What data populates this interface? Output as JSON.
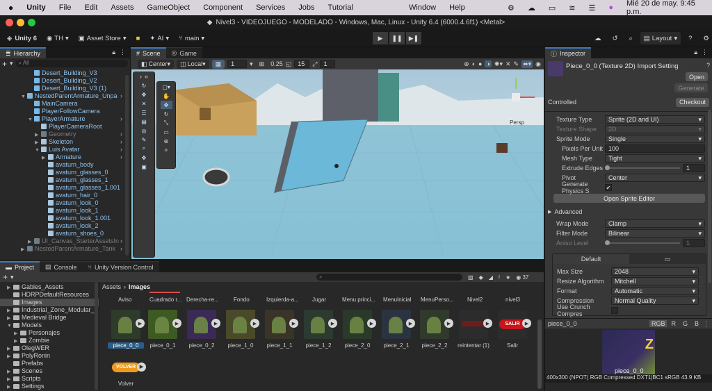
{
  "mac": {
    "app": "Unity",
    "menus": [
      "File",
      "Edit",
      "Assets",
      "GameObject",
      "Component",
      "Services",
      "Jobs",
      "Tutorial"
    ],
    "right_menus": [
      "Window",
      "Help"
    ],
    "clock": "Mié 20 de may.  9:45 p.m."
  },
  "window_title": "Nivel3 - VIDEOJUEGO - MODELADO - Windows, Mac, Linux - Unity 6.4 (6000.4.6f1) <Metal>",
  "toolbar": {
    "unity_label": "Unity 6",
    "account": "TH",
    "asset_store": "Asset Store",
    "ai": "AI",
    "branch": "main",
    "layout": "Layout"
  },
  "hierarchy": {
    "tab": "Hierarchy",
    "search_placeholder": "All",
    "items": [
      {
        "label": "Desert_Building_V3",
        "indent": 1,
        "icon": "cube",
        "color": "blue",
        "arrow": ""
      },
      {
        "label": "Desert_Building_V2",
        "indent": 1,
        "icon": "cube",
        "color": "blue",
        "arrow": ""
      },
      {
        "label": "Desert_Building_V3 (1)",
        "indent": 1,
        "icon": "cube",
        "color": "blue",
        "arrow": ""
      },
      {
        "label": "NestedParentArmature_Unpa",
        "indent": 0,
        "icon": "cube",
        "color": "blue",
        "arrow": "▼"
      },
      {
        "label": "MainCamera",
        "indent": 1,
        "icon": "cube",
        "color": "blue",
        "arrow": ""
      },
      {
        "label": "PlayerFollowCamera",
        "indent": 1,
        "icon": "cube",
        "color": "blue",
        "arrow": ""
      },
      {
        "label": "PlayerArmature",
        "indent": 1,
        "icon": "cube",
        "color": "blue",
        "arrow": "▼"
      },
      {
        "label": "PlayerCameraRoot",
        "indent": 2,
        "icon": "sub",
        "color": "blue",
        "arrow": ""
      },
      {
        "label": "Geometry",
        "indent": 2,
        "icon": "gray",
        "color": "gray",
        "arrow": "▶"
      },
      {
        "label": "Skeleton",
        "indent": 2,
        "icon": "sub",
        "color": "blue",
        "arrow": "▶"
      },
      {
        "label": "Luis Avatar",
        "indent": 2,
        "icon": "sub",
        "color": "blue",
        "arrow": "▼"
      },
      {
        "label": "Armature",
        "indent": 3,
        "icon": "sub",
        "color": "blue",
        "arrow": "▶"
      },
      {
        "label": "avaturn_body",
        "indent": 3,
        "icon": "sub",
        "color": "blue",
        "arrow": ""
      },
      {
        "label": "avaturn_glasses_0",
        "indent": 3,
        "icon": "sub",
        "color": "blue",
        "arrow": ""
      },
      {
        "label": "avaturn_glasses_1",
        "indent": 3,
        "icon": "sub",
        "color": "blue",
        "arrow": ""
      },
      {
        "label": "avaturn_glasses_1.001",
        "indent": 3,
        "icon": "sub",
        "color": "blue",
        "arrow": ""
      },
      {
        "label": "avaturn_hair_0",
        "indent": 3,
        "icon": "sub",
        "color": "blue",
        "arrow": ""
      },
      {
        "label": "avaturn_look_0",
        "indent": 3,
        "icon": "sub",
        "color": "blue",
        "arrow": ""
      },
      {
        "label": "avaturn_look_1",
        "indent": 3,
        "icon": "sub",
        "color": "blue",
        "arrow": ""
      },
      {
        "label": "avaturn_look_1.001",
        "indent": 3,
        "icon": "sub",
        "color": "blue",
        "arrow": ""
      },
      {
        "label": "avaturn_look_2",
        "indent": 3,
        "icon": "sub",
        "color": "blue",
        "arrow": ""
      },
      {
        "label": "avaturn_shoes_0",
        "indent": 3,
        "icon": "sub",
        "color": "blue",
        "arrow": ""
      },
      {
        "label": "UI_Canvas_StarterAssetsIn",
        "indent": 1,
        "icon": "gray",
        "color": "gray",
        "arrow": "▶"
      },
      {
        "label": "NestedParentArmature_Tank",
        "indent": 0,
        "icon": "gray",
        "color": "gray",
        "arrow": "▶"
      }
    ]
  },
  "scene": {
    "tabs": [
      "Scene",
      "Game"
    ],
    "pivot": "Center",
    "space": "Local",
    "grid_value": "1",
    "snap_value": "0.25",
    "angle_value": "15",
    "scale_value": "1",
    "view_label": "Persp"
  },
  "inspector": {
    "tab": "Inspector",
    "asset_title": "Piece_0_0 (Texture 2D) Import Setting",
    "open_btn": "Open",
    "generate_btn": "Generate",
    "controlled": "Controlled",
    "checkout_btn": "Checkout",
    "rows": [
      {
        "label": "Texture Type",
        "value": "Sprite (2D and UI)",
        "kind": "dd"
      },
      {
        "label": "Texture Shape",
        "value": "2D",
        "kind": "dd-dim"
      },
      {
        "label": "Sprite Mode",
        "value": "Single",
        "kind": "dd"
      },
      {
        "label": "Pixels Per Unit",
        "value": "100",
        "kind": "field",
        "sub": true
      },
      {
        "label": "Mesh Type",
        "value": "Tight",
        "kind": "dd",
        "sub": true
      },
      {
        "label": "Extrude Edges",
        "value": "1",
        "kind": "slider",
        "sub": true
      },
      {
        "label": "Pivot",
        "value": "Center",
        "kind": "dd",
        "sub": true
      },
      {
        "label": "Generate Physics S",
        "value": "✔",
        "kind": "check",
        "sub": true
      }
    ],
    "sprite_editor_btn": "Open Sprite Editor",
    "advanced": "Advanced",
    "rows2": [
      {
        "label": "Wrap Mode",
        "value": "Clamp",
        "kind": "dd"
      },
      {
        "label": "Filter Mode",
        "value": "Bilinear",
        "kind": "dd"
      },
      {
        "label": "Aniso Level",
        "value": "1",
        "kind": "slider-dim"
      }
    ],
    "platform_tab": "Default",
    "rows3": [
      {
        "label": "Max Size",
        "value": "2048"
      },
      {
        "label": "Resize Algorithm",
        "value": "Mitchell"
      },
      {
        "label": "Format",
        "value": "Automatic"
      },
      {
        "label": "Compression",
        "value": "Normal Quality"
      },
      {
        "label": "Use Crunch Compres",
        "value": ""
      }
    ],
    "preview_name": "piece_0_0",
    "channels": [
      "RGB",
      "R",
      "G",
      "B"
    ],
    "preview_caption": "piece_0_0",
    "preview_info": "400x300 (NPOT)  RGB Compressed DXT1|BC1 sRGB   43.9 KB"
  },
  "bottom": {
    "tabs": [
      "Project",
      "Console",
      "Unity Version Control"
    ],
    "breadcrumb": [
      "Assets",
      "Images"
    ],
    "count": "37",
    "folders": [
      {
        "label": "Gabies_Assets",
        "indent": 0,
        "arrow": "▶"
      },
      {
        "label": "HDRPDefaultResources",
        "indent": 0,
        "arrow": ""
      },
      {
        "label": "Images",
        "indent": 0,
        "arrow": "",
        "selected": true
      },
      {
        "label": "Industrial_Zone_Modular_I",
        "indent": 0,
        "arrow": "▶"
      },
      {
        "label": "Medieval Bridge",
        "indent": 0,
        "arrow": "▶"
      },
      {
        "label": "Models",
        "indent": 0,
        "arrow": "▼"
      },
      {
        "label": "Personajes",
        "indent": 1,
        "arrow": "▶"
      },
      {
        "label": "Zombie",
        "indent": 1,
        "arrow": "▶"
      },
      {
        "label": "OlegWER",
        "indent": 0,
        "arrow": "▶"
      },
      {
        "label": "PolyRonin",
        "indent": 0,
        "arrow": "▶"
      },
      {
        "label": "Prefabs",
        "indent": 0,
        "arrow": ""
      },
      {
        "label": "Scenes",
        "indent": 0,
        "arrow": "▶"
      },
      {
        "label": "Scripts",
        "indent": 0,
        "arrow": "▶"
      },
      {
        "label": "Settings",
        "indent": 0,
        "arrow": "▶"
      }
    ],
    "column_headers": [
      "Aviso",
      "Cuadrado r...",
      "Derecha-re...",
      "Fondo",
      "Izquierda-a...",
      "Jugar",
      "Menu princi...",
      "MenuInicial",
      "MenuPerso...",
      "Nivel2",
      "nivel3"
    ],
    "assets": [
      {
        "label": "piece_0_0",
        "color": "#2e3b2a",
        "selected": true
      },
      {
        "label": "piece_0_1",
        "color": "#3d5a22"
      },
      {
        "label": "piece_0_2",
        "color": "#3a2a55"
      },
      {
        "label": "piece_1_0",
        "color": "#4a4a2a"
      },
      {
        "label": "piece_1_1",
        "color": "#3a3428"
      },
      {
        "label": "piece_1_2",
        "color": "#2c3a30"
      },
      {
        "label": "piece_2_0",
        "color": "#2a3a2a"
      },
      {
        "label": "piece_2_1",
        "color": "#2b3340"
      },
      {
        "label": "piece_2_2",
        "color": "#303a2c"
      },
      {
        "label": "reintentar (1)",
        "color": "#2c2c2c"
      },
      {
        "label": "Salir",
        "color": "#2c2c2c"
      }
    ],
    "salir_text": "SALIR",
    "volver_text": "VOLVER",
    "volver_label": "Volver"
  }
}
